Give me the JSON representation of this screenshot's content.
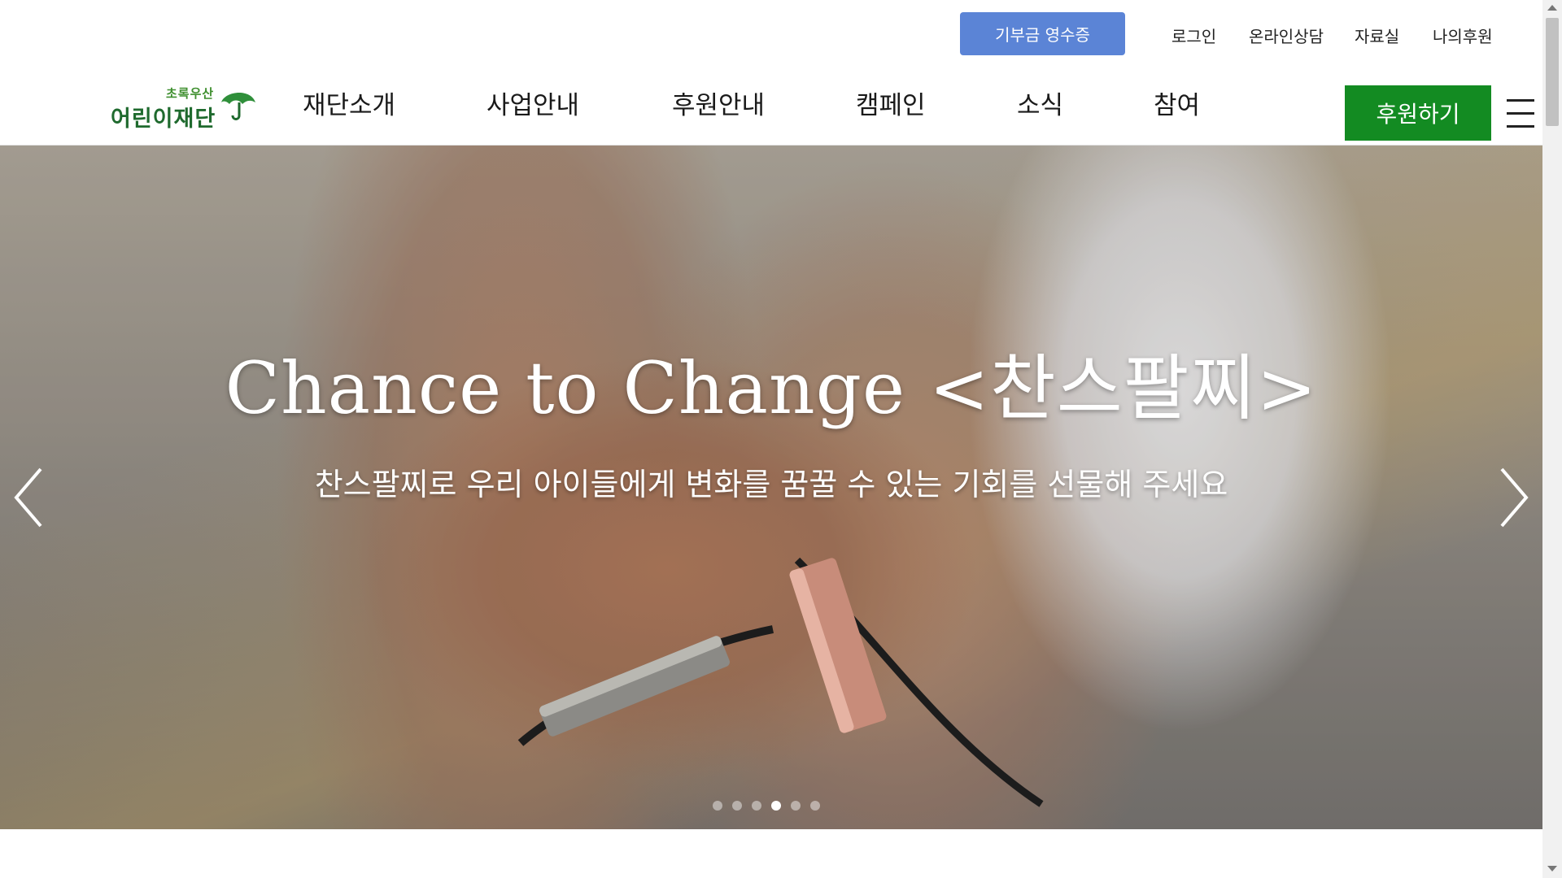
{
  "utility": {
    "receipt_label": "기부금 영수증",
    "links": [
      "로그인",
      "온라인상담",
      "자료실",
      "나의후원"
    ]
  },
  "logo": {
    "small_text": "초록우산",
    "big_text": "어린이재단"
  },
  "nav": {
    "items": [
      "재단소개",
      "사업안내",
      "후원안내",
      "캠페인",
      "소식",
      "참여"
    ],
    "donate_label": "후원하기"
  },
  "hero": {
    "title": "Chance to Change <찬스팔찌>",
    "subtitle": "찬스팔찌로 우리 아이들에게 변화를 꿈꿀 수 있는 기회를 선물해 주세요",
    "slide_count": 6,
    "active_slide": 4
  },
  "colors": {
    "receipt_button": "#5b84d6",
    "donate_button": "#138b22",
    "logo_green": "#1f6a2e"
  }
}
